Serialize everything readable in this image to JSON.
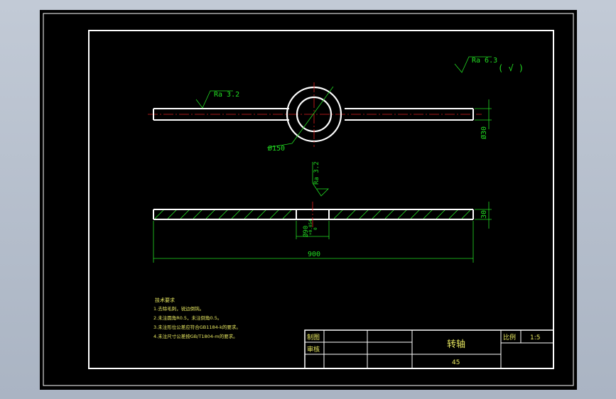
{
  "roughness": {
    "general": "Ra 6.3",
    "general_brackets": "( √ )",
    "top_view": "Ra 3.2",
    "section_view": "Ra 3.2"
  },
  "dimensions": {
    "ring_diameter": "Ø150",
    "top_thickness": "Ø30",
    "section_thickness": "30",
    "bore": "Ø90",
    "bore_tol_upper": "+0.054",
    "bore_tol_lower": "0",
    "overall_length": "900"
  },
  "notes": {
    "title": "技术要求",
    "items": [
      "1.去除毛刺，锐边倒钝。",
      "2.未注圆角R0.5，未注倒角0.5。",
      "3.未注形位公差应符合GB1184-k的要求。",
      "4.未注尺寸公差按GB/T1804-m的要求。"
    ]
  },
  "title_block": {
    "drawn_label": "制图",
    "checked_label": "审核",
    "part_name": "转轴",
    "scale_label": "比例",
    "scale_value": "1:5",
    "material": "45"
  },
  "colors": {
    "background": "#000000",
    "outline": "#ffffff",
    "dimension": "#22dd22",
    "centerline": "#e02020",
    "note_text": "#e8e860",
    "hatch": "#22dd22"
  }
}
